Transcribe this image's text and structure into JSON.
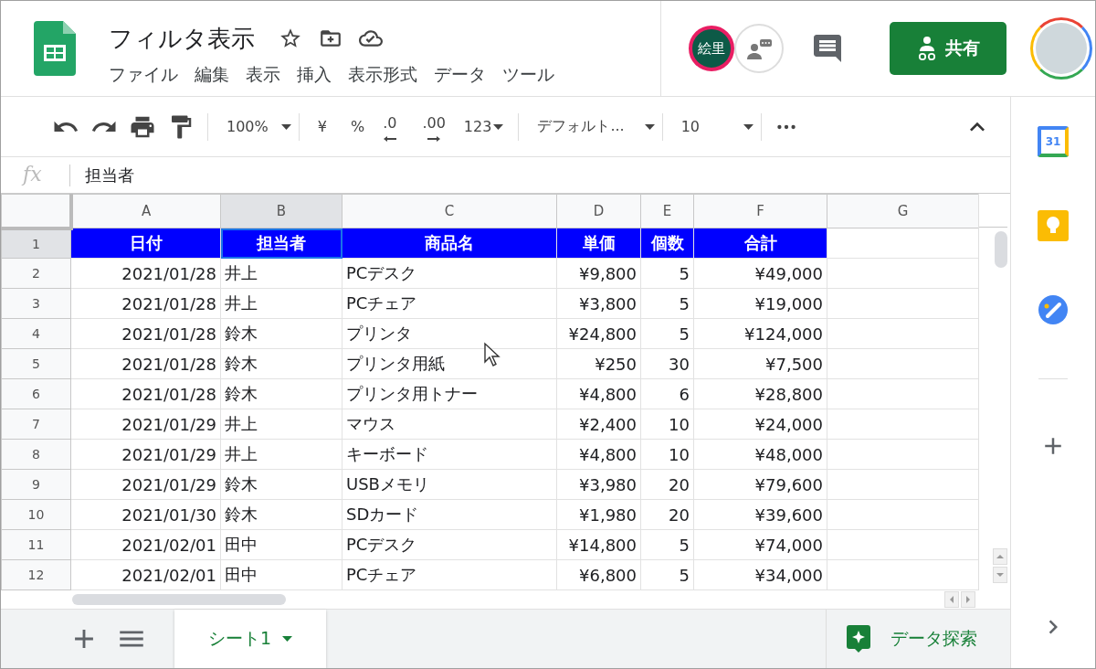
{
  "document": {
    "title": "フィルタ表示"
  },
  "menu": [
    "ファイル",
    "編集",
    "表示",
    "挿入",
    "表示形式",
    "データ",
    "ツール"
  ],
  "collaborator": {
    "initials": "絵里"
  },
  "share_button": {
    "label": "共有"
  },
  "toolbar": {
    "zoom": "100%",
    "currency": "¥",
    "percent": "%",
    "decrease_decimals": ".0",
    "increase_decimals": ".00",
    "number_format": "123",
    "font": "デフォルト...",
    "font_size": "10"
  },
  "formula_bar": {
    "fx": "fx",
    "value": "担当者"
  },
  "columns": [
    {
      "label": "A",
      "selected": false
    },
    {
      "label": "B",
      "selected": true
    },
    {
      "label": "C",
      "selected": false
    },
    {
      "label": "D",
      "selected": false
    },
    {
      "label": "E",
      "selected": false
    },
    {
      "label": "F",
      "selected": false
    },
    {
      "label": "G",
      "selected": false
    }
  ],
  "rows": [
    {
      "number": "1",
      "kind": "header",
      "selected": true,
      "cells": [
        "日付",
        "担当者",
        "商品名",
        "単価",
        "個数",
        "合計"
      ]
    },
    {
      "number": "2",
      "kind": "data",
      "selected": false,
      "cells": [
        "2021/01/28",
        "井上",
        "PCデスク",
        "¥9,800",
        "5",
        "¥49,000"
      ]
    },
    {
      "number": "3",
      "kind": "data",
      "selected": false,
      "cells": [
        "2021/01/28",
        "井上",
        "PCチェア",
        "¥3,800",
        "5",
        "¥19,000"
      ]
    },
    {
      "number": "4",
      "kind": "data",
      "selected": false,
      "cells": [
        "2021/01/28",
        "鈴木",
        "プリンタ",
        "¥24,800",
        "5",
        "¥124,000"
      ]
    },
    {
      "number": "5",
      "kind": "data",
      "selected": false,
      "cells": [
        "2021/01/28",
        "鈴木",
        "プリンタ用紙",
        "¥250",
        "30",
        "¥7,500"
      ]
    },
    {
      "number": "6",
      "kind": "data",
      "selected": false,
      "cells": [
        "2021/01/28",
        "鈴木",
        "プリンタ用トナー",
        "¥4,800",
        "6",
        "¥28,800"
      ]
    },
    {
      "number": "7",
      "kind": "data",
      "selected": false,
      "cells": [
        "2021/01/29",
        "井上",
        "マウス",
        "¥2,400",
        "10",
        "¥24,000"
      ]
    },
    {
      "number": "8",
      "kind": "data",
      "selected": false,
      "cells": [
        "2021/01/29",
        "井上",
        "キーボード",
        "¥4,800",
        "10",
        "¥48,000"
      ]
    },
    {
      "number": "9",
      "kind": "data",
      "selected": false,
      "cells": [
        "2021/01/29",
        "鈴木",
        "USBメモリ",
        "¥3,980",
        "20",
        "¥79,600"
      ]
    },
    {
      "number": "10",
      "kind": "data",
      "selected": false,
      "cells": [
        "2021/01/30",
        "鈴木",
        "SDカード",
        "¥1,980",
        "20",
        "¥39,600"
      ]
    },
    {
      "number": "11",
      "kind": "data",
      "selected": false,
      "cells": [
        "2021/02/01",
        "田中",
        "PCデスク",
        "¥14,800",
        "5",
        "¥74,000"
      ]
    },
    {
      "number": "12",
      "kind": "data",
      "selected": false,
      "cells": [
        "2021/02/01",
        "田中",
        "PCチェア",
        "¥6,800",
        "5",
        "¥34,000"
      ]
    }
  ],
  "sheet_tabs": [
    {
      "label": "シート1",
      "selected": true
    }
  ],
  "explore_button": {
    "label": "データ探索"
  },
  "side_panel": {
    "calendar_day": "31"
  }
}
